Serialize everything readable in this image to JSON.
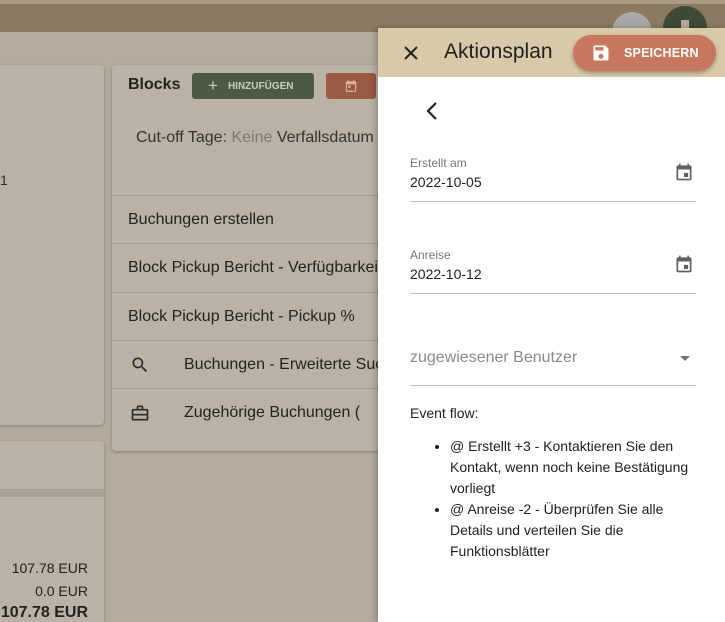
{
  "background": {
    "left_value": "1",
    "amounts": [
      "107.78 EUR",
      "0.0 EUR",
      "107.78 EUR"
    ],
    "blocks": {
      "title": "Blocks",
      "add_label": "HINZUFÜGEN",
      "cutoff_label": "Cut-off Tage:",
      "cutoff_value": "Keine",
      "expiry_label": "Verfallsdatum",
      "rows": [
        "Buchungen erstellen",
        "Block Pickup Bericht - Verfügbarkeit",
        "Block Pickup Bericht - Pickup %",
        "Buchungen - Erweiterte Suche",
        "Zugehörige Buchungen ("
      ]
    }
  },
  "drawer": {
    "title": "Aktionsplan",
    "save_label": "SPEICHERN",
    "fields": {
      "created": {
        "label": "Erstellt am",
        "value": "2022-10-05"
      },
      "arrival": {
        "label": "Anreise",
        "value": "2022-10-12"
      },
      "assigned_user": {
        "placeholder": "zugewiesener Benutzer"
      }
    },
    "event_flow_label": "Event flow:",
    "event_flow": [
      "@ Erstellt +3 - Kontaktieren Sie den Kontakt, wenn noch keine Bestätigung vorliegt",
      "@ Anreise -2 - Überprüfen Sie alle Details und verteilen Sie die Funktionsblätter"
    ]
  },
  "colors": {
    "header_bg": "#d8c9a8",
    "save_button": "#c8765e",
    "add_button": "#4b5a40",
    "overlay_bg": "#b4ab9d"
  },
  "icons": [
    "close-icon",
    "save-icon",
    "back-arrow-icon",
    "calendar-icon",
    "dropdown-arrow-icon",
    "plus-icon",
    "search-icon",
    "briefcase-icon"
  ]
}
